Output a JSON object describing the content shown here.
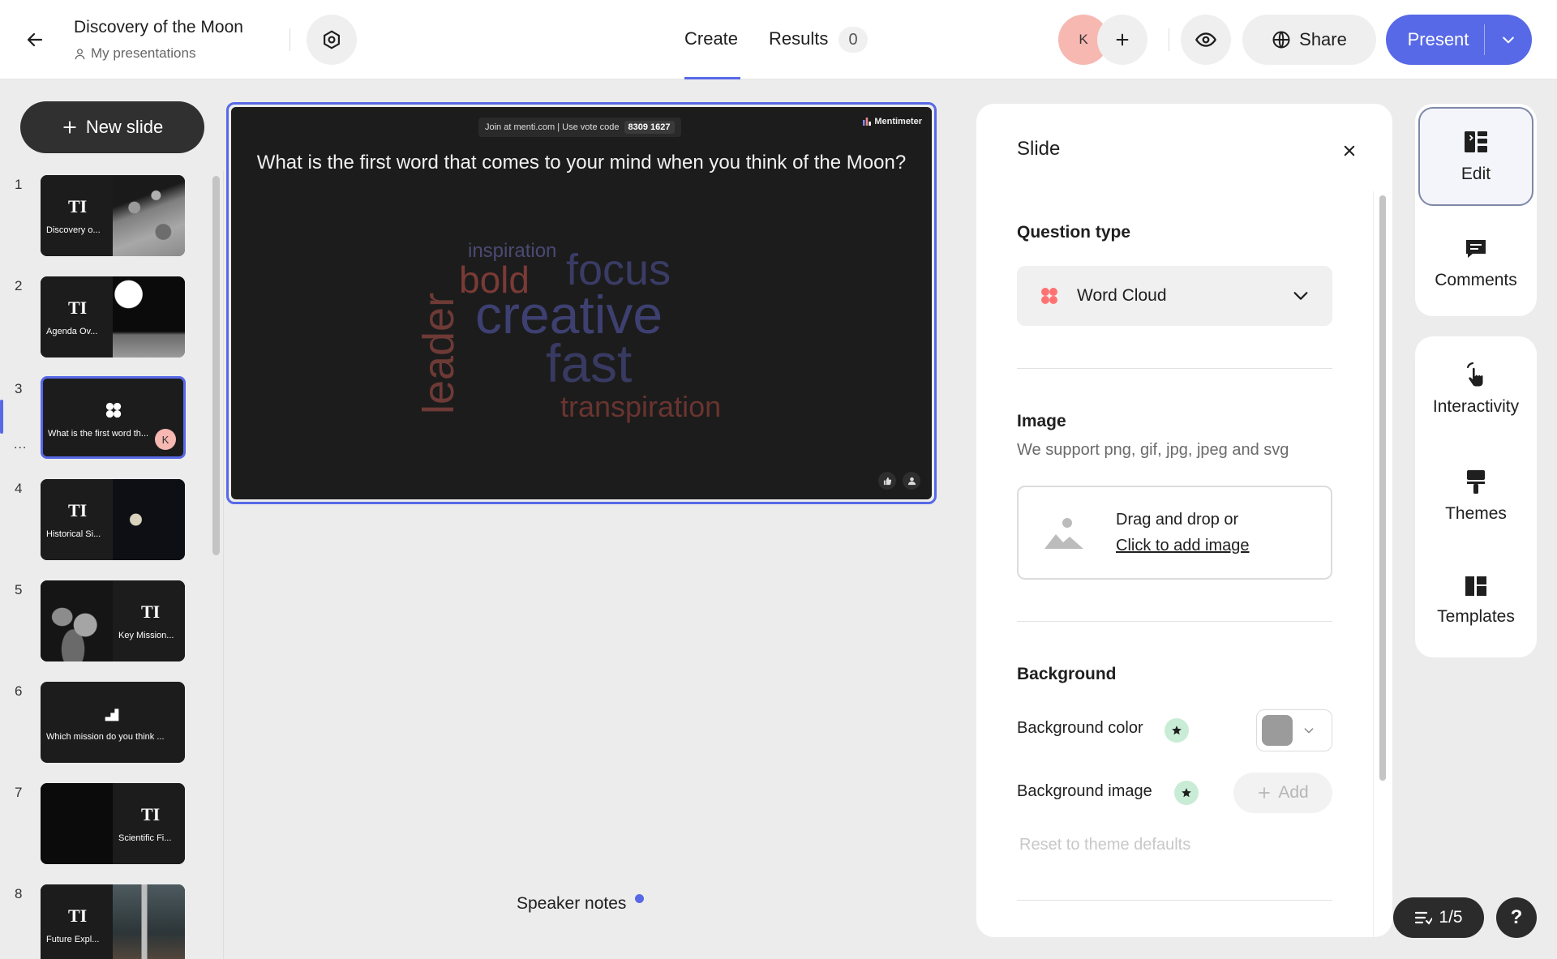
{
  "header": {
    "title": "Discovery of the Moon",
    "location": "My presentations",
    "tabs": [
      {
        "label": "Create",
        "active": true
      },
      {
        "label": "Results",
        "badge": "0"
      }
    ],
    "collaborator_initial": "K",
    "share_label": "Share",
    "present_label": "Present",
    "accent_color": "#5769e7"
  },
  "sidebar": {
    "new_slide_label": "New slide",
    "dots": "...",
    "slides": [
      {
        "num": "1",
        "label": "Discovery o...",
        "type": "title"
      },
      {
        "num": "2",
        "label": "Agenda Ov...",
        "type": "title"
      },
      {
        "num": "3",
        "label": "What is the first word th...",
        "type": "wordcloud",
        "active": true,
        "avatar": "K"
      },
      {
        "num": "4",
        "label": "Historical Si...",
        "type": "title"
      },
      {
        "num": "5",
        "label": "Key Mission...",
        "type": "title"
      },
      {
        "num": "6",
        "label": "Which mission do you think ...",
        "type": "ranking"
      },
      {
        "num": "7",
        "label": "Scientific Fi...",
        "type": "title"
      },
      {
        "num": "8",
        "label": "Future Expl...",
        "type": "title"
      }
    ],
    "ti_glyph": "TI"
  },
  "canvas": {
    "join_text": "Join at menti.com | Use vote code",
    "vote_code": "8309 1627",
    "brand": "Mentimeter",
    "question": "What is the first word that comes to your mind when you think of the Moon?",
    "words": [
      {
        "text": "inspiration",
        "color": "#4a4a74"
      },
      {
        "text": "bold",
        "color": "#7a3a36"
      },
      {
        "text": "focus",
        "color": "#3a3c66"
      },
      {
        "text": "creative",
        "color": "#3d4070"
      },
      {
        "text": "fast",
        "color": "#383a62"
      },
      {
        "text": "leader",
        "color": "#6e3a36"
      },
      {
        "text": "transpiration",
        "color": "#6a3430"
      }
    ]
  },
  "speaker_notes_label": "Speaker notes",
  "panel": {
    "title": "Slide",
    "question_type_heading": "Question type",
    "question_type_value": "Word Cloud",
    "image_heading": "Image",
    "image_support": "We support png, gif, jpg, jpeg and svg",
    "drop_line1": "Drag and drop or",
    "drop_line2": "Click to add image",
    "background_heading": "Background",
    "background_color_label": "Background color",
    "background_image_label": "Background image",
    "add_label": "Add",
    "reset_label": "Reset to theme defaults",
    "swatch_color": "#9b9b9b"
  },
  "rail": {
    "edit": "Edit",
    "comments": "Comments",
    "interactivity": "Interactivity",
    "themes": "Themes",
    "templates": "Templates"
  },
  "footer": {
    "counter": "1/5",
    "help": "?"
  }
}
